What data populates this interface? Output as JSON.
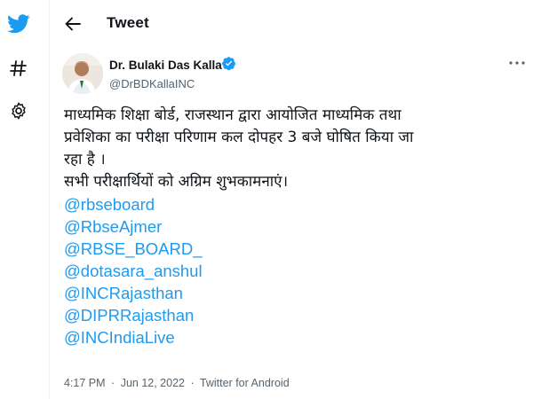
{
  "header": {
    "title": "Tweet"
  },
  "sidebar": {
    "items": [
      {
        "icon": "twitter-bird-icon"
      },
      {
        "icon": "hashtag-icon"
      },
      {
        "icon": "gear-icon"
      }
    ]
  },
  "tweet": {
    "author_name": "Dr. Bulaki Das Kalla",
    "author_handle": "@DrBDKallaINC",
    "verified": true,
    "text_lines": [
      "माध्यमिक शिक्षा बोर्ड, राजस्थान द्वारा आयोजित माध्यमिक तथा",
      "प्रवेशिका का परीक्षा परिणाम कल  दोपहर 3 बजे घोषित किया जा",
      "रहा है ।",
      "सभी परीक्षार्थियों को अग्रिम शुभकामनाएं।"
    ],
    "mentions": [
      "@rbseboard",
      "@RbseAjmer",
      "@RBSE_BOARD_",
      "@dotasara_anshul",
      "@INCRajasthan",
      "@DIPRRajasthan",
      "@INCIndiaLive"
    ],
    "time": "4:17 PM",
    "separator": "·",
    "date": "Jun 12, 2022",
    "source": "Twitter for Android"
  },
  "colors": {
    "accent": "#1d9bf0",
    "text": "#0f1419",
    "muted": "#536471"
  }
}
